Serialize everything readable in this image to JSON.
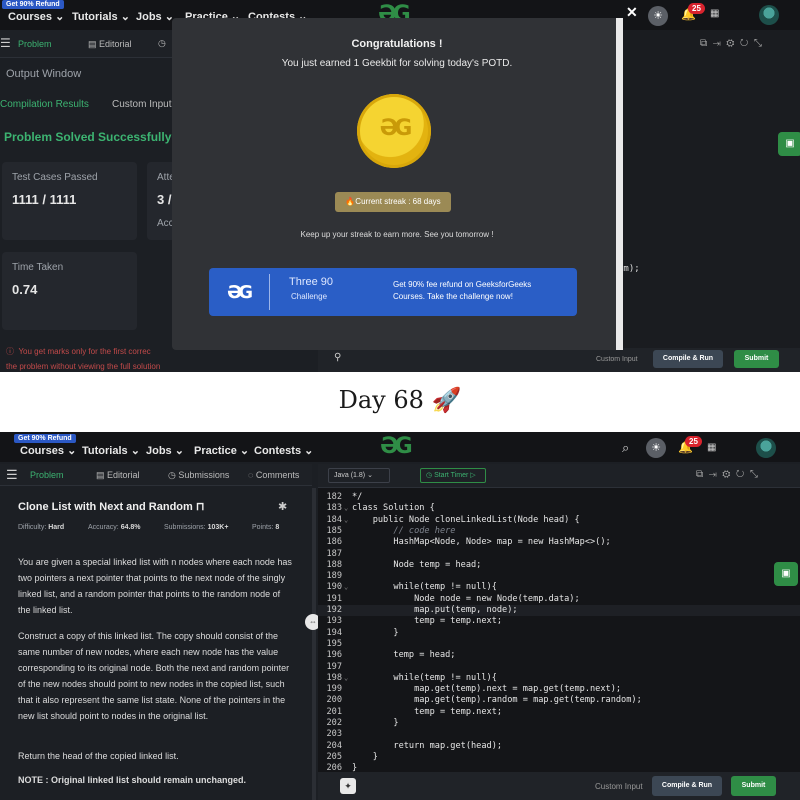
{
  "nav": {
    "refund_tag": "Get 90% Refund",
    "items": [
      "Courses",
      "Tutorials",
      "Jobs",
      "Practice",
      "Contests"
    ],
    "notification_count": "25"
  },
  "top": {
    "tabs": [
      "Problem",
      "Editorial"
    ],
    "output_title": "Output Window",
    "result_tabs": [
      "Compilation Results",
      "Custom Input"
    ],
    "solved_text": "Problem Solved Successfully",
    "cards": [
      {
        "label": "Test Cases Passed",
        "value": "1111 / 1111"
      },
      {
        "label": "Atte",
        "value": "3 /",
        "extra": "Acc"
      },
      {
        "label": "Time Taken",
        "value": "0.74"
      }
    ],
    "notice": "You get marks only for the first correc",
    "notice2": "the problem without viewing the full solution",
    "code_fragment": "om);",
    "custom_input": "Custom Input",
    "compile_label": "Compile & Run",
    "submit_label": "Submit",
    "modal": {
      "title": "Congratulations !",
      "earned": "You just earned 1 Geekbit for solving today's POTD.",
      "streak": "Current streak : 68 days",
      "keep_up": "Keep up your streak to earn more. See you tomorrow !",
      "banner_brand": "Three 90",
      "banner_brand_sub": "Challenge",
      "banner_text": "Get 90% fee refund on GeeksforGeeks Courses. Take the challenge now!"
    }
  },
  "caption": {
    "title": "Day 68 🚀"
  },
  "bottom": {
    "tabs": [
      "Problem",
      "Editorial",
      "Submissions",
      "Comments"
    ],
    "language": "Java (1.8)",
    "timer_label": "Start Timer",
    "problem": {
      "title": "Clone List with Next and Random",
      "difficulty_label": "Difficulty:",
      "difficulty": "Hard",
      "accuracy_label": "Accuracy:",
      "accuracy": "64.8%",
      "submissions_label": "Submissions:",
      "submissions": "103K+",
      "points_label": "Points:",
      "points": "8",
      "para1": "You are given a special linked list with n nodes where each node has two pointers a next pointer that points to the next node of the singly linked list, and a random pointer that points to the random node of the linked list.",
      "para2": "Construct a copy of this linked list. The copy should consist of the same number of new nodes, where each new node has the value corresponding to its original node. Both the next and random pointer of the new nodes should point to new nodes in the copied list, such that it also represent the same list state. None of the pointers in the new list should point to nodes in the original list.",
      "para3": "Return the head of the copied linked list.",
      "note": "NOTE : Original linked list should remain unchanged."
    },
    "code_lines": [
      {
        "n": "182",
        "t": "*/"
      },
      {
        "n": "183",
        "t": "class Solution {"
      },
      {
        "n": "184",
        "t": "    public Node cloneLinkedList(Node head) {"
      },
      {
        "n": "185",
        "t": "        // code here"
      },
      {
        "n": "186",
        "t": "        HashMap<Node, Node> map = new HashMap<>();"
      },
      {
        "n": "187",
        "t": ""
      },
      {
        "n": "188",
        "t": "        Node temp = head;"
      },
      {
        "n": "189",
        "t": ""
      },
      {
        "n": "190",
        "t": "        while(temp != null){"
      },
      {
        "n": "191",
        "t": "            Node node = new Node(temp.data);"
      },
      {
        "n": "192",
        "t": "            map.put(temp, node);"
      },
      {
        "n": "193",
        "t": "            temp = temp.next;"
      },
      {
        "n": "194",
        "t": "        }"
      },
      {
        "n": "195",
        "t": ""
      },
      {
        "n": "196",
        "t": "        temp = head;"
      },
      {
        "n": "197",
        "t": ""
      },
      {
        "n": "198",
        "t": "        while(temp != null){"
      },
      {
        "n": "199",
        "t": "            map.get(temp).next = map.get(temp.next);"
      },
      {
        "n": "200",
        "t": "            map.get(temp).random = map.get(temp.random);"
      },
      {
        "n": "201",
        "t": "            temp = temp.next;"
      },
      {
        "n": "202",
        "t": "        }"
      },
      {
        "n": "203",
        "t": ""
      },
      {
        "n": "204",
        "t": "        return map.get(head);"
      },
      {
        "n": "205",
        "t": "    }"
      },
      {
        "n": "206",
        "t": "}"
      }
    ],
    "custom_input": "Custom Input",
    "compile_label": "Compile & Run",
    "submit_label": "Submit"
  }
}
